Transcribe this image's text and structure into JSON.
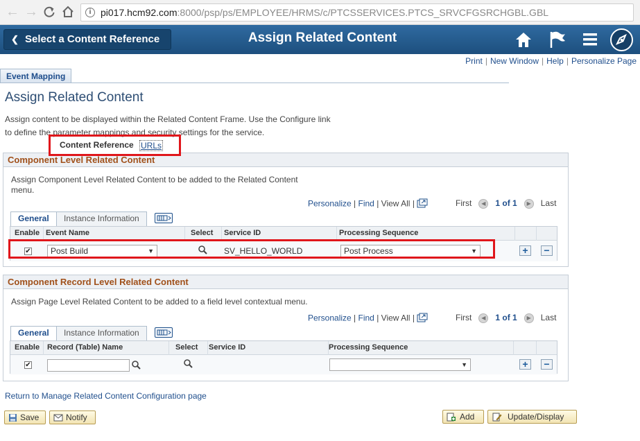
{
  "browser": {
    "url_host": "pi017.hcm92.com",
    "url_rest": ":8000/psp/ps/EMPLOYEE/HRMS/c/PTCSSERVICES.PTCS_SRVCFGSRCHGBL.GBL",
    "icons": [
      "back-icon",
      "forward-icon",
      "reload-icon",
      "home-icon",
      "info-icon"
    ]
  },
  "banner": {
    "back_label": "Select a Content Reference",
    "title": "Assign Related Content",
    "icons": [
      "home-icon",
      "flag-icon",
      "menu-icon",
      "navbar-compass-icon"
    ],
    "colors": {
      "banner_bg": "#2a639a",
      "back_bg": "#17446d"
    }
  },
  "top_links": {
    "print": "Print",
    "new_window": "New Window",
    "help": "Help",
    "personalize_page": "Personalize Page",
    "separator": "|"
  },
  "page_tab": {
    "label": "Event Mapping"
  },
  "page": {
    "title": "Assign Related Content",
    "description": "Assign content to be displayed within the Related Content Frame. Use the Configure link to define the parameter mappings and security settings for the service."
  },
  "sub_tabs": {
    "active": "Content Reference",
    "urls": "URLs"
  },
  "component_section": {
    "title": "Component Level Related Content",
    "description": "Assign Component Level Related Content to be added to the Related Content menu.",
    "grid_nav": {
      "personalize": "Personalize",
      "find": "Find",
      "view_all": "View All",
      "first": "First",
      "count": "1 of 1",
      "last": "Last",
      "sep": "|"
    },
    "tabs": {
      "general": "General",
      "instance": "Instance Information"
    },
    "headers": {
      "enable": "Enable",
      "event_name": "Event Name",
      "select": "Select",
      "service_id": "Service ID",
      "processing_sequence": "Processing Sequence"
    },
    "row": {
      "enabled": true,
      "event_name": "Post Build",
      "service_id": "SV_HELLO_WORLD",
      "processing_sequence": "Post Process"
    },
    "highlight_color": "#e0161b"
  },
  "record_section": {
    "title": "Component Record Level Related Content",
    "description": "Assign Page Level Related Content to be added to a field level contextual menu.",
    "grid_nav": {
      "personalize": "Personalize",
      "find": "Find",
      "view_all": "View All",
      "first": "First",
      "count": "1 of 1",
      "last": "Last",
      "sep": "|"
    },
    "tabs": {
      "general": "General",
      "instance": "Instance Information"
    },
    "headers": {
      "enable": "Enable",
      "record_name": "Record (Table) Name",
      "select": "Select",
      "service_id": "Service ID",
      "processing_sequence": "Processing Sequence"
    },
    "row": {
      "enabled": true,
      "record_name": "",
      "service_id": "",
      "processing_sequence": ""
    }
  },
  "footer": {
    "return_link": "Return to Manage Related Content Configuration page",
    "save": "Save",
    "notify": "Notify",
    "add": "Add",
    "update_display": "Update/Display"
  },
  "glyphs": {
    "check": "✔",
    "plus": "+",
    "minus": "−",
    "dropdown": "▼",
    "prev": "◀",
    "next": "▶",
    "chevron_left": "❮"
  }
}
